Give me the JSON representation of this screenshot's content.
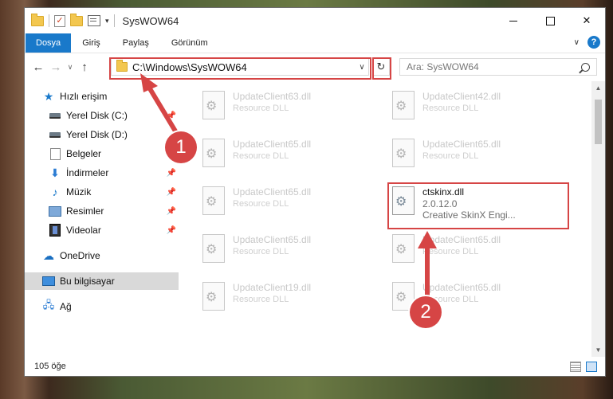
{
  "window": {
    "title": "SysWOW64",
    "controls": {
      "minimize": "",
      "maximize": "",
      "close": "✕"
    }
  },
  "ribbon": {
    "tabs": [
      "Dosya",
      "Giriş",
      "Paylaş",
      "Görünüm"
    ],
    "help": "?"
  },
  "navigation": {
    "back": "←",
    "forward": "→",
    "recent": "∨",
    "up": "↑",
    "address": "C:\\Windows\\SysWOW64",
    "refresh": "↻",
    "search_placeholder": "Ara: SysWOW64"
  },
  "sidebar": {
    "items": [
      {
        "label": "Hızlı erişim",
        "icon": "star-icon"
      },
      {
        "label": "Yerel Disk (C:)",
        "icon": "disk-icon",
        "pinned": true
      },
      {
        "label": "Yerel Disk (D:)",
        "icon": "disk-icon"
      },
      {
        "label": "Belgeler",
        "icon": "document-icon",
        "pinned": true
      },
      {
        "label": "İndirmeler",
        "icon": "download-icon",
        "pinned": true
      },
      {
        "label": "Müzik",
        "icon": "music-icon",
        "pinned": true
      },
      {
        "label": "Resimler",
        "icon": "picture-icon",
        "pinned": true
      },
      {
        "label": "Videolar",
        "icon": "video-icon",
        "pinned": true
      },
      {
        "label": "OneDrive",
        "icon": "cloud-icon"
      },
      {
        "label": "Bu bilgisayar",
        "icon": "computer-icon",
        "selected": true
      },
      {
        "label": "Ağ",
        "icon": "network-icon"
      }
    ]
  },
  "files": [
    {
      "name": "UpdateClient63.dll",
      "type": "Resource DLL"
    },
    {
      "name": "UpdateClient42.dll",
      "type": "Resource DLL"
    },
    {
      "name": "UpdateClient65.dll",
      "type": "Resource DLL"
    },
    {
      "name": "UpdateClient65.dll",
      "type": "Resource DLL"
    },
    {
      "name": "UpdateClient65.dll",
      "type": "Resource DLL"
    },
    {
      "name": "ctskinx.dll",
      "version": "2.0.12.0",
      "description": "Creative SkinX Engi...",
      "highlighted": true
    },
    {
      "name": "UpdateClient65.dll",
      "type": "Resource DLL"
    },
    {
      "name": "UpdateClient65.dll",
      "type": "Resource DLL"
    },
    {
      "name": "UpdateClient19.dll",
      "type": "Resource DLL"
    },
    {
      "name": "UpdateClient65.dll",
      "type": "Resource DLL"
    }
  ],
  "status": {
    "item_count": "105 öğe"
  },
  "annotations": {
    "step1": "1",
    "step2": "2",
    "color": "#d64545"
  },
  "colors": {
    "accent": "#1979ca",
    "highlight_box": "#d64545"
  }
}
